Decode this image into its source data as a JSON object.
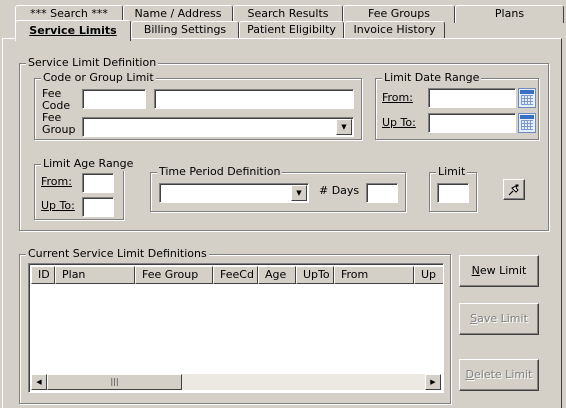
{
  "tabs_back": [
    "*** Search ***",
    "Name / Address",
    "Search Results",
    "Fee Groups",
    "Plans"
  ],
  "tabs_front": [
    "Service Limits",
    "Billing Settings",
    "Patient Eligibilty",
    "Invoice History"
  ],
  "service_limit_definition": {
    "title": "Service Limit Definition",
    "code_group": {
      "title": "Code or Group Limit",
      "fee_code_label": "Fee\nCode",
      "fee_code_value": "",
      "fee_code_desc": "",
      "fee_group_label": "Fee\nGroup",
      "fee_group_value": ""
    },
    "date_range": {
      "title": "Limit Date Range",
      "from_label": "From:",
      "up_to_label": "Up To:",
      "from_value": "",
      "up_to_value": ""
    },
    "age_range": {
      "title": "Limit Age Range",
      "from_label": "From:",
      "up_to_label": "Up To:",
      "from_value": "",
      "up_to_value": ""
    },
    "time_period": {
      "title": "Time Period Definition",
      "period_value": "",
      "days_label": "# Days",
      "days_value": ""
    },
    "limit": {
      "title": "Limit",
      "value": ""
    },
    "pin_icon": "pin-icon"
  },
  "current_definitions": {
    "title": "Current Service Limit Definitions",
    "columns": [
      "ID",
      "Plan",
      "Fee Group",
      "FeeCd",
      "Age",
      "UpTo",
      "From",
      "Up"
    ],
    "rows": [],
    "scroll_left_icon": "scroll-left-icon",
    "scroll_right_icon": "scroll-right-icon",
    "thumb_grip": "|||"
  },
  "buttons": {
    "new_limit": "New Limit",
    "save_limit": "Save Limit",
    "delete_limit": "Delete Limit"
  }
}
